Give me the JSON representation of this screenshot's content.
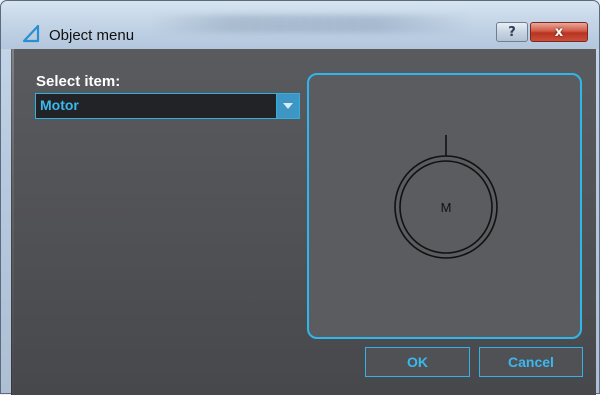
{
  "window": {
    "title": "Object menu",
    "help_label": "?",
    "close_label": "x"
  },
  "form": {
    "select_label": "Select item:",
    "selected_item": "Motor"
  },
  "preview": {
    "symbol_text": "M"
  },
  "buttons": {
    "ok_label": "OK",
    "cancel_label": "Cancel"
  },
  "colors": {
    "accent": "#2fb6ec",
    "panel_bg": "#55565a",
    "close_red": "#c9503a"
  },
  "icons": {
    "app": "triangle-ruler-icon",
    "help": "question-mark-icon",
    "close": "close-icon",
    "dropdown": "chevron-down-icon"
  }
}
